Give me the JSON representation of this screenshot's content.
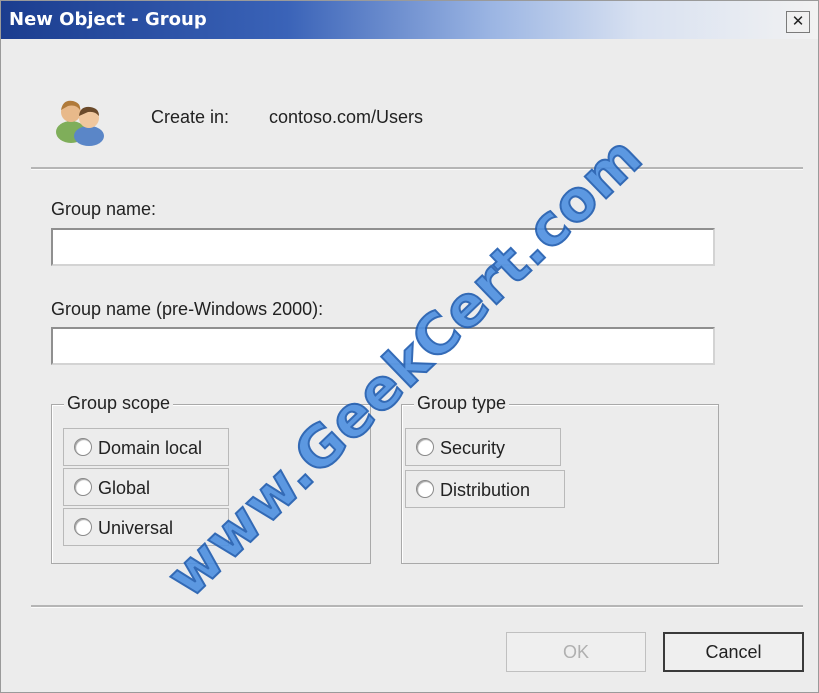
{
  "window": {
    "title": "New Object - Group",
    "close_glyph": "✕"
  },
  "header": {
    "icon": "users-group-icon",
    "create_in_label": "Create in:",
    "create_in_value": "contoso.com/Users"
  },
  "form": {
    "group_name_label": "Group name:",
    "group_name_value": "",
    "group_name_pre2000_label": "Group name (pre-Windows 2000):",
    "group_name_pre2000_value": ""
  },
  "group_scope": {
    "legend": "Group scope",
    "options": [
      {
        "label": "Domain local",
        "selected": false
      },
      {
        "label": "Global",
        "selected": false
      },
      {
        "label": "Universal",
        "selected": false
      }
    ]
  },
  "group_type": {
    "legend": "Group type",
    "options": [
      {
        "label": "Security",
        "selected": false
      },
      {
        "label": "Distribution",
        "selected": false
      }
    ]
  },
  "buttons": {
    "ok_label": "OK",
    "ok_enabled": false,
    "cancel_label": "Cancel"
  },
  "watermark": {
    "text": "www.GeekCert.com"
  },
  "colors": {
    "title_bar_start": "#1b3d8f",
    "watermark": "#4d8fe0"
  }
}
